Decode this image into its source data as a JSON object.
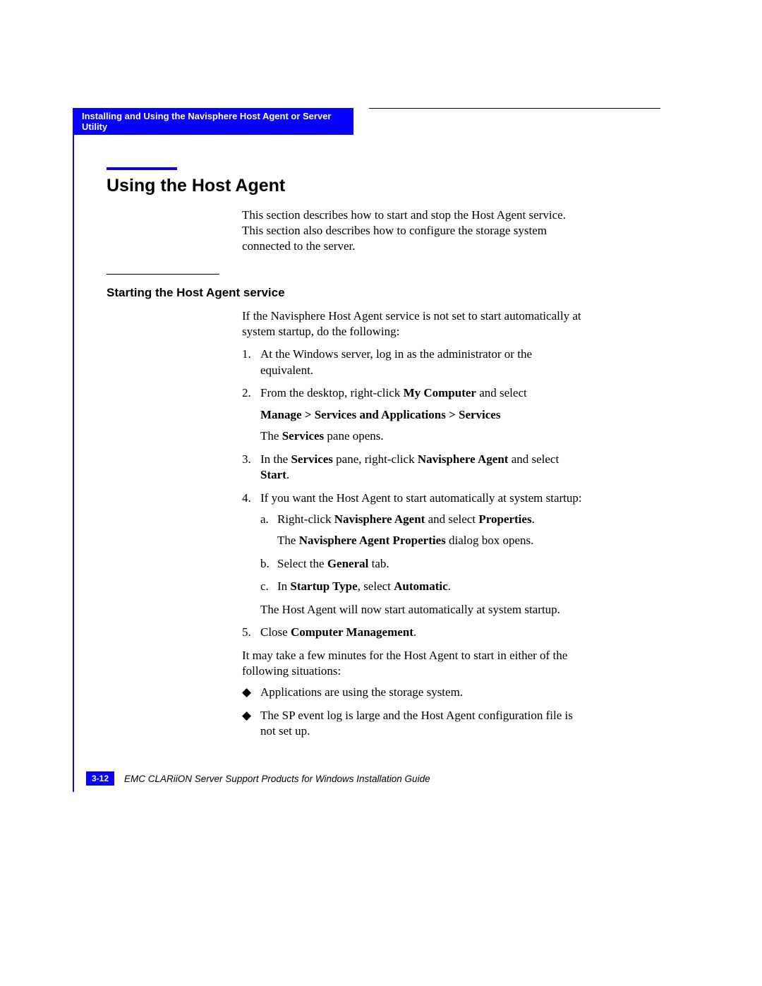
{
  "header": {
    "chapter_title": "Installing and Using the Navisphere Host Agent or Server Utility"
  },
  "section": {
    "title": "Using the Host Agent",
    "intro": "This section describes how to start and stop the Host Agent service. This section also describes how to configure the storage system connected to the server."
  },
  "subsection": {
    "title": "Starting the Host Agent service",
    "intro": "If the Navisphere Host Agent service is not set to start automatically at system startup, do the following:",
    "steps": {
      "s1": {
        "num": "1.",
        "text": "At the Windows server, log in as the administrator or the equivalent."
      },
      "s2": {
        "num": "2.",
        "text_pre": "From the desktop, right-click ",
        "bold1": "My Computer",
        "text_post": " and select",
        "path": "Manage > Services and Applications > Services",
        "result_pre": "The ",
        "result_bold": "Services",
        "result_post": " pane opens."
      },
      "s3": {
        "num": "3.",
        "t1": "In the ",
        "b1": "Services",
        "t2": " pane, right-click ",
        "b2": "Navisphere Agent",
        "t3": " and select ",
        "b3": "Start",
        "t4": "."
      },
      "s4": {
        "num": "4.",
        "text": "If you want the Host Agent to start automatically at system startup:",
        "a": {
          "num": "a.",
          "t1": "Right-click ",
          "b1": "Navisphere Agent",
          "t2": " and select ",
          "b2": "Properties",
          "t3": ".",
          "r1": "The ",
          "rb": "Navisphere Agent Properties",
          "r2": " dialog box opens."
        },
        "b": {
          "num": "b.",
          "t1": "Select the ",
          "b1": "General",
          "t2": " tab."
        },
        "c": {
          "num": "c.",
          "t1": "In ",
          "b1": "Startup Type",
          "t2": ", select ",
          "b2": "Automatic",
          "t3": "."
        },
        "after": "The Host Agent will now start automatically at system startup."
      },
      "s5": {
        "num": "5.",
        "t1": "Close ",
        "b1": "Computer Management",
        "t2": "."
      }
    },
    "after_steps": "It may take a few minutes for the Host Agent to start in either of the following situations:",
    "bullets": {
      "mark": "◆",
      "b1": "Applications are using the storage system.",
      "b2": "The SP event log is large and the Host Agent configuration file is not set up."
    }
  },
  "footer": {
    "page_num": "3-12",
    "doc_title": "EMC CLARiiON Server Support Products for Windows Installation Guide"
  }
}
